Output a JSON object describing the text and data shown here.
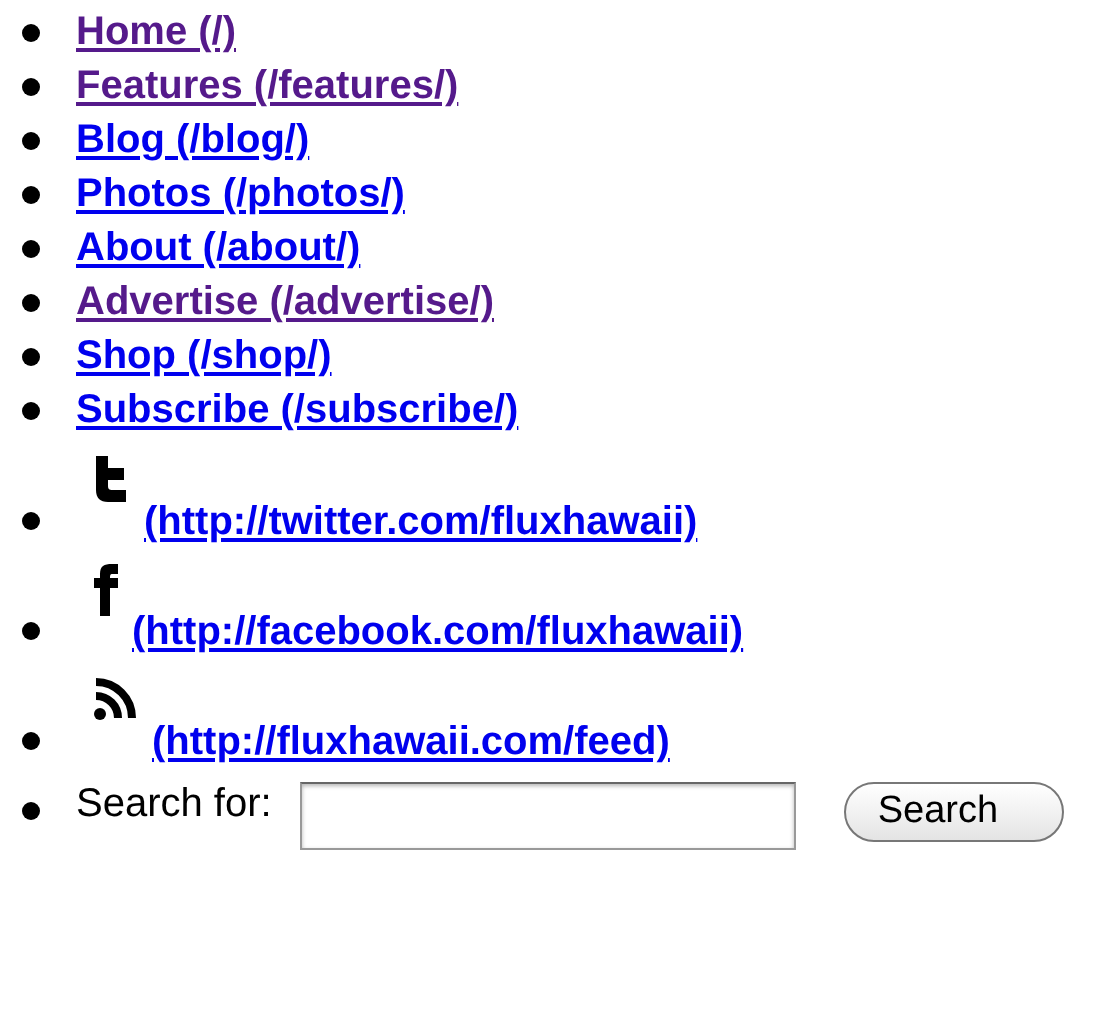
{
  "nav_links": [
    {
      "label": "Home",
      "path": "(/)",
      "visited": true
    },
    {
      "label": "Features",
      "path": "(/features/)",
      "visited": true
    },
    {
      "label": "Blog",
      "path": "(/blog/)",
      "visited": false
    },
    {
      "label": "Photos",
      "path": "(/photos/)",
      "visited": false
    },
    {
      "label": "About",
      "path": "(/about/)",
      "visited": false
    },
    {
      "label": "Advertise",
      "path": "(/advertise/)",
      "visited": true
    },
    {
      "label": "Shop",
      "path": "(/shop/)",
      "visited": false
    },
    {
      "label": "Subscribe",
      "path": "(/subscribe/)",
      "visited": false
    }
  ],
  "social_links": [
    {
      "kind": "twitter",
      "url": "(http://twitter.com/fluxhawaii)",
      "visited": false
    },
    {
      "kind": "facebook",
      "url": "(http://facebook.com/fluxhawaii)",
      "visited": false
    },
    {
      "kind": "feed",
      "url": "(http://fluxhawaii.com/feed)",
      "visited": false
    }
  ],
  "search": {
    "label": "Search for:",
    "button": "Search"
  }
}
